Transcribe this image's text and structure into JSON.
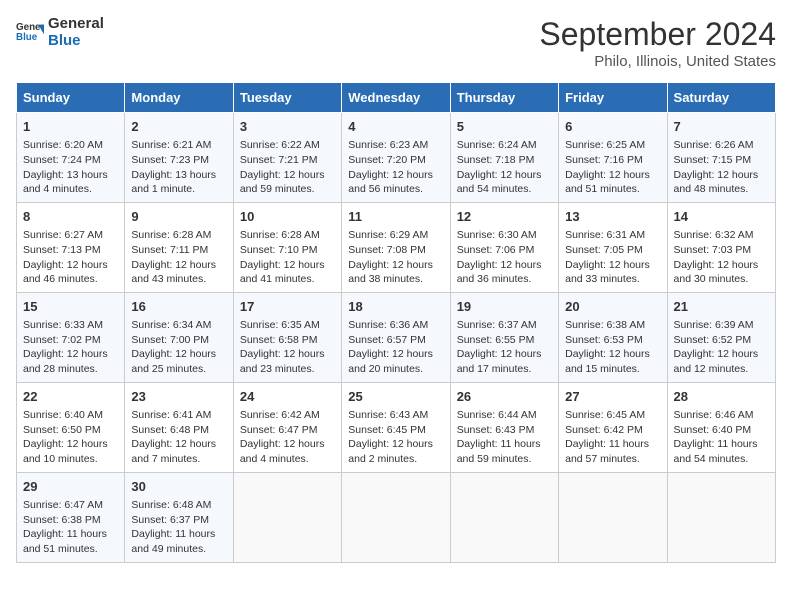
{
  "header": {
    "logo_general": "General",
    "logo_blue": "Blue",
    "title": "September 2024",
    "subtitle": "Philo, Illinois, United States"
  },
  "days_of_week": [
    "Sunday",
    "Monday",
    "Tuesday",
    "Wednesday",
    "Thursday",
    "Friday",
    "Saturday"
  ],
  "weeks": [
    [
      {
        "day": 1,
        "lines": [
          "Sunrise: 6:20 AM",
          "Sunset: 7:24 PM",
          "Daylight: 13 hours",
          "and 4 minutes."
        ]
      },
      {
        "day": 2,
        "lines": [
          "Sunrise: 6:21 AM",
          "Sunset: 7:23 PM",
          "Daylight: 13 hours",
          "and 1 minute."
        ]
      },
      {
        "day": 3,
        "lines": [
          "Sunrise: 6:22 AM",
          "Sunset: 7:21 PM",
          "Daylight: 12 hours",
          "and 59 minutes."
        ]
      },
      {
        "day": 4,
        "lines": [
          "Sunrise: 6:23 AM",
          "Sunset: 7:20 PM",
          "Daylight: 12 hours",
          "and 56 minutes."
        ]
      },
      {
        "day": 5,
        "lines": [
          "Sunrise: 6:24 AM",
          "Sunset: 7:18 PM",
          "Daylight: 12 hours",
          "and 54 minutes."
        ]
      },
      {
        "day": 6,
        "lines": [
          "Sunrise: 6:25 AM",
          "Sunset: 7:16 PM",
          "Daylight: 12 hours",
          "and 51 minutes."
        ]
      },
      {
        "day": 7,
        "lines": [
          "Sunrise: 6:26 AM",
          "Sunset: 7:15 PM",
          "Daylight: 12 hours",
          "and 48 minutes."
        ]
      }
    ],
    [
      {
        "day": 8,
        "lines": [
          "Sunrise: 6:27 AM",
          "Sunset: 7:13 PM",
          "Daylight: 12 hours",
          "and 46 minutes."
        ]
      },
      {
        "day": 9,
        "lines": [
          "Sunrise: 6:28 AM",
          "Sunset: 7:11 PM",
          "Daylight: 12 hours",
          "and 43 minutes."
        ]
      },
      {
        "day": 10,
        "lines": [
          "Sunrise: 6:28 AM",
          "Sunset: 7:10 PM",
          "Daylight: 12 hours",
          "and 41 minutes."
        ]
      },
      {
        "day": 11,
        "lines": [
          "Sunrise: 6:29 AM",
          "Sunset: 7:08 PM",
          "Daylight: 12 hours",
          "and 38 minutes."
        ]
      },
      {
        "day": 12,
        "lines": [
          "Sunrise: 6:30 AM",
          "Sunset: 7:06 PM",
          "Daylight: 12 hours",
          "and 36 minutes."
        ]
      },
      {
        "day": 13,
        "lines": [
          "Sunrise: 6:31 AM",
          "Sunset: 7:05 PM",
          "Daylight: 12 hours",
          "and 33 minutes."
        ]
      },
      {
        "day": 14,
        "lines": [
          "Sunrise: 6:32 AM",
          "Sunset: 7:03 PM",
          "Daylight: 12 hours",
          "and 30 minutes."
        ]
      }
    ],
    [
      {
        "day": 15,
        "lines": [
          "Sunrise: 6:33 AM",
          "Sunset: 7:02 PM",
          "Daylight: 12 hours",
          "and 28 minutes."
        ]
      },
      {
        "day": 16,
        "lines": [
          "Sunrise: 6:34 AM",
          "Sunset: 7:00 PM",
          "Daylight: 12 hours",
          "and 25 minutes."
        ]
      },
      {
        "day": 17,
        "lines": [
          "Sunrise: 6:35 AM",
          "Sunset: 6:58 PM",
          "Daylight: 12 hours",
          "and 23 minutes."
        ]
      },
      {
        "day": 18,
        "lines": [
          "Sunrise: 6:36 AM",
          "Sunset: 6:57 PM",
          "Daylight: 12 hours",
          "and 20 minutes."
        ]
      },
      {
        "day": 19,
        "lines": [
          "Sunrise: 6:37 AM",
          "Sunset: 6:55 PM",
          "Daylight: 12 hours",
          "and 17 minutes."
        ]
      },
      {
        "day": 20,
        "lines": [
          "Sunrise: 6:38 AM",
          "Sunset: 6:53 PM",
          "Daylight: 12 hours",
          "and 15 minutes."
        ]
      },
      {
        "day": 21,
        "lines": [
          "Sunrise: 6:39 AM",
          "Sunset: 6:52 PM",
          "Daylight: 12 hours",
          "and 12 minutes."
        ]
      }
    ],
    [
      {
        "day": 22,
        "lines": [
          "Sunrise: 6:40 AM",
          "Sunset: 6:50 PM",
          "Daylight: 12 hours",
          "and 10 minutes."
        ]
      },
      {
        "day": 23,
        "lines": [
          "Sunrise: 6:41 AM",
          "Sunset: 6:48 PM",
          "Daylight: 12 hours",
          "and 7 minutes."
        ]
      },
      {
        "day": 24,
        "lines": [
          "Sunrise: 6:42 AM",
          "Sunset: 6:47 PM",
          "Daylight: 12 hours",
          "and 4 minutes."
        ]
      },
      {
        "day": 25,
        "lines": [
          "Sunrise: 6:43 AM",
          "Sunset: 6:45 PM",
          "Daylight: 12 hours",
          "and 2 minutes."
        ]
      },
      {
        "day": 26,
        "lines": [
          "Sunrise: 6:44 AM",
          "Sunset: 6:43 PM",
          "Daylight: 11 hours",
          "and 59 minutes."
        ]
      },
      {
        "day": 27,
        "lines": [
          "Sunrise: 6:45 AM",
          "Sunset: 6:42 PM",
          "Daylight: 11 hours",
          "and 57 minutes."
        ]
      },
      {
        "day": 28,
        "lines": [
          "Sunrise: 6:46 AM",
          "Sunset: 6:40 PM",
          "Daylight: 11 hours",
          "and 54 minutes."
        ]
      }
    ],
    [
      {
        "day": 29,
        "lines": [
          "Sunrise: 6:47 AM",
          "Sunset: 6:38 PM",
          "Daylight: 11 hours",
          "and 51 minutes."
        ]
      },
      {
        "day": 30,
        "lines": [
          "Sunrise: 6:48 AM",
          "Sunset: 6:37 PM",
          "Daylight: 11 hours",
          "and 49 minutes."
        ]
      },
      null,
      null,
      null,
      null,
      null
    ]
  ]
}
